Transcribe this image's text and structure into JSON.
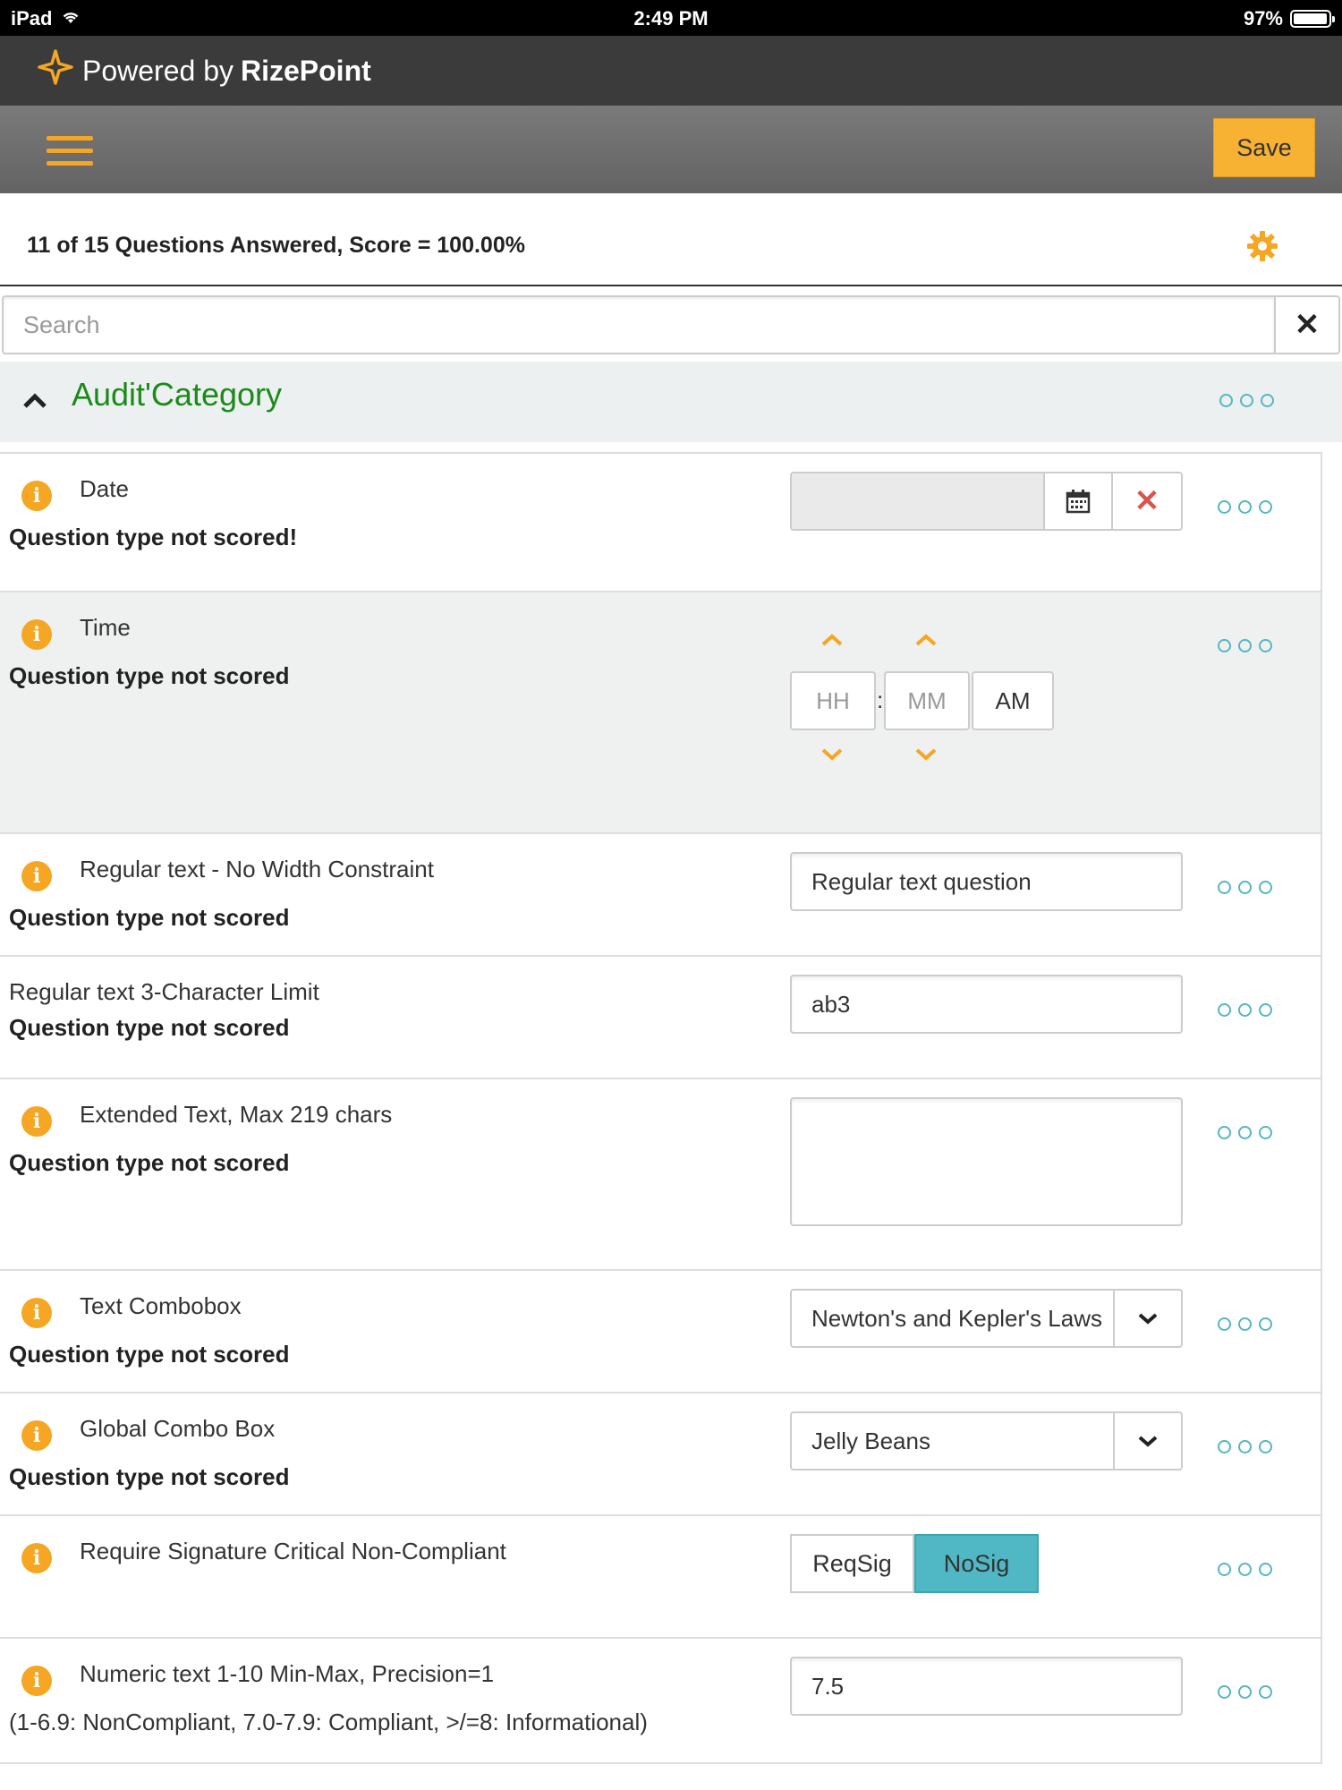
{
  "status_bar": {
    "device": "iPad",
    "time": "2:49 PM",
    "battery": "97%",
    "battery_level": 0.97
  },
  "brand": {
    "prefix": "Powered by",
    "name": "RizePoint"
  },
  "toolbar": {
    "save_label": "Save",
    "menu_icon": "hamburger-menu-icon"
  },
  "summary": {
    "text": "11 of 15 Questions Answered, Score = 100.00%",
    "settings_icon": "gear-icon"
  },
  "search": {
    "placeholder": "Search",
    "value": ""
  },
  "category": {
    "title": "Audit'Category"
  },
  "colors": {
    "accent": "#f5a623",
    "category_title": "#1b8a1b",
    "teal": "#4fb8c4",
    "clear_red": "#d9534f",
    "toolbar_bg": "#6b6b6b",
    "brand_bg": "#3b3b3b"
  },
  "questions": [
    {
      "label": "Date",
      "note": "Question type not scored!",
      "type": "date",
      "value": ""
    },
    {
      "label": "Time",
      "note": "Question type not scored",
      "type": "time",
      "hh_placeholder": "HH",
      "mm_placeholder": "MM",
      "ampm": "AM",
      "separator": ":"
    },
    {
      "label": "Regular text - No Width Constraint",
      "note": "Question type not scored",
      "type": "text",
      "value": "Regular text question"
    },
    {
      "label": "Regular text 3-Character Limit",
      "note": "Question type not scored",
      "type": "text",
      "value": "ab3"
    },
    {
      "label": "Extended Text, Max 219 chars",
      "note": "Question type not scored",
      "type": "textarea",
      "value": ""
    },
    {
      "label": "Text Combobox",
      "note": "Question type not scored",
      "type": "combo",
      "value": "Newton's and Kepler's Laws"
    },
    {
      "label": "Global Combo Box",
      "note": "Question type not scored",
      "type": "combo",
      "value": "Jelly Beans"
    },
    {
      "label": "Require Signature Critical Non-Compliant",
      "note": "",
      "type": "toggle",
      "options": [
        "ReqSig",
        "NoSig"
      ],
      "selected": "NoSig"
    },
    {
      "label": "Numeric text 1-10 Min-Max, Precision=1",
      "note": "(1-6.9: NonCompliant, 7.0-7.9: Compliant, >/=8: Informational)",
      "type": "number",
      "value": "7.5"
    }
  ]
}
